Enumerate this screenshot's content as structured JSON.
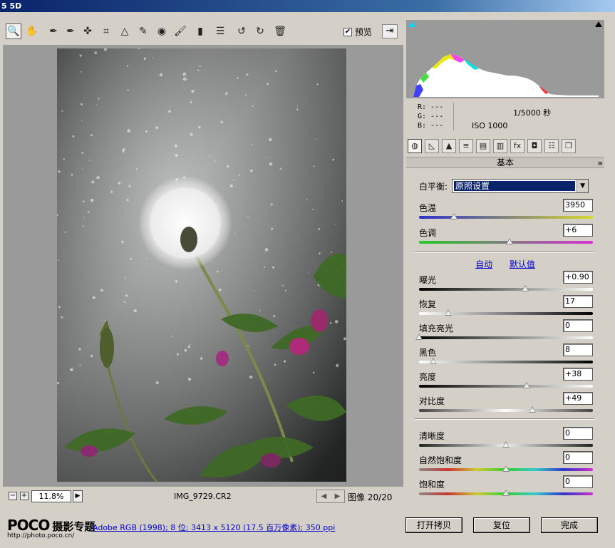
{
  "window": {
    "title": "5 5D"
  },
  "toolbar": {
    "tools": [
      "zoom-icon",
      "hand-icon",
      "white-balance-icon",
      "color-sampler-icon",
      "target-adjust-icon",
      "crop-icon",
      "straighten-icon",
      "spot-removal-icon",
      "red-eye-icon",
      "adjustment-brush-icon",
      "graduated-filter-icon",
      "preferences-icon",
      "rotate-left-icon",
      "rotate-right-icon",
      "trash-icon"
    ],
    "tool_glyphs": [
      "🔍",
      "✋",
      "✒",
      "✒",
      "✜",
      "⌗",
      "△",
      "✎",
      "◉",
      "🖌",
      "▮",
      "☰",
      "↺",
      "↻",
      "🗑"
    ],
    "preview_label": "预览",
    "preview_checked": "✔",
    "export_glyph": "⇥"
  },
  "bottombar": {
    "zoom": "11.8%",
    "minus": "−",
    "plus": "+",
    "zoom_arrow": "▶",
    "filename": "IMG_9729.CR2",
    "prev": "◀",
    "next": "▶",
    "image_count": "图像 20/20"
  },
  "footer": {
    "logo_main": "POCO",
    "logo_cn": "摄影专题",
    "logo_url": "http://photo.poco.cn/",
    "workflow_link": "Adobe RGB (1998); 8 位; 3413 x 5120 (17.5 百万像素); 350 ppi",
    "open_copy": "打开拷贝",
    "reset": "复位",
    "done": "完成"
  },
  "info": {
    "r": "R: ---",
    "g": "G: ---",
    "b": "B: ---",
    "shutter": "1/5000 秒",
    "iso": "ISO 1000"
  },
  "tabs": [
    "basic-tab-icon",
    "tone-curve-tab-icon",
    "detail-tab-icon",
    "hsl-tab-icon",
    "split-tone-tab-icon",
    "lens-tab-icon",
    "effects-tab-icon",
    "camera-calibration-tab-icon",
    "presets-tab-icon",
    "snapshots-tab-icon"
  ],
  "tab_glyphs": [
    "◍",
    "◺",
    "▲",
    "≡",
    "▤",
    "▥",
    "fx",
    "◘",
    "☷",
    "❐"
  ],
  "panel": {
    "section_title": "基本",
    "section_menu": "≡",
    "white_balance_label": "白平衡:",
    "white_balance_value": "原照设置",
    "dropdown_glyph": "▼",
    "auto_label": "自动",
    "default_label": "默认值",
    "sliders": [
      {
        "key": "temp",
        "label": "色温",
        "value": "3950",
        "fraction": 0.2,
        "track": "linear-gradient(to right,#2a34c8,#d8d830)"
      },
      {
        "key": "tint",
        "label": "色调",
        "value": "+6",
        "fraction": 0.52,
        "track": "linear-gradient(to right,#28c828,#d830d8)"
      },
      {
        "key": "exposure",
        "label": "曝光",
        "value": "+0.90",
        "fraction": 0.61,
        "track": "linear-gradient(to right,#000,#fff)"
      },
      {
        "key": "recovery",
        "label": "恢复",
        "value": "17",
        "fraction": 0.17,
        "track": "linear-gradient(to right,#fff,#000)"
      },
      {
        "key": "fill_light",
        "label": "填充亮光",
        "value": "0",
        "fraction": 0.0,
        "track": "linear-gradient(to right,#000,#fff)"
      },
      {
        "key": "blacks",
        "label": "黑色",
        "value": "8",
        "fraction": 0.08,
        "track": "linear-gradient(to right,#fff,#000)"
      },
      {
        "key": "brightness",
        "label": "亮度",
        "value": "+38",
        "fraction": 0.62,
        "track": "linear-gradient(to right,#000,#fff)"
      },
      {
        "key": "contrast",
        "label": "对比度",
        "value": "+49",
        "fraction": 0.65,
        "track": "linear-gradient(to right,#444,#fff 50%,#444)"
      },
      {
        "key": "clarity",
        "label": "清晰度",
        "value": "0",
        "fraction": 0.5,
        "track": "linear-gradient(to right,#222,#eee 50%,#222)"
      },
      {
        "key": "vibrance",
        "label": "自然饱和度",
        "value": "0",
        "fraction": 0.5,
        "track": "linear-gradient(to right,#888,#c33,#cc3,#3c3,#3cc,#33c,#c3c)"
      },
      {
        "key": "saturation",
        "label": "饱和度",
        "value": "0",
        "fraction": 0.5,
        "track": "linear-gradient(to right,#888,#c33,#cc3,#3c3,#3cc,#33c,#c3c)"
      }
    ]
  }
}
